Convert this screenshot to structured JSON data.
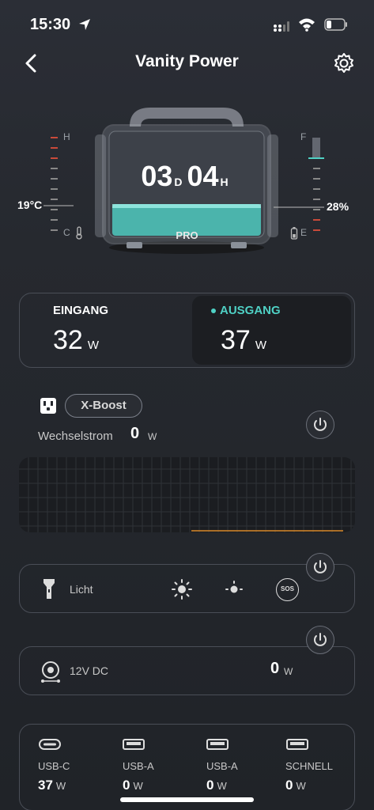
{
  "status_bar": {
    "time": "15:30"
  },
  "header": {
    "title": "Vanity Power"
  },
  "device": {
    "temperature": "19°C",
    "temp_scale_high": "H",
    "temp_scale_low": "C",
    "battery_percent": "28%",
    "battery_level": 0.28,
    "batt_scale_full": "F",
    "batt_scale_empty": "E",
    "runtime_days": "03",
    "runtime_days_unit": "D",
    "runtime_hours": "04",
    "runtime_hours_unit": "H",
    "model_label": "PRO"
  },
  "io": {
    "input_label": "EINGANG",
    "input_value": "32",
    "input_unit": "W",
    "output_label": "AUSGANG",
    "output_value": "37",
    "output_unit": "W"
  },
  "ac": {
    "boost_label": "X-Boost",
    "label": "Wechselstrom",
    "value": "0",
    "unit": "W"
  },
  "light": {
    "label": "Licht",
    "mode_sos": "SOS"
  },
  "dc": {
    "label": "12V DC",
    "value": "0",
    "unit": "W"
  },
  "usb": {
    "ports": [
      {
        "label": "USB-C",
        "value": "37",
        "unit": "W"
      },
      {
        "label": "USB-A",
        "value": "0",
        "unit": "W"
      },
      {
        "label": "USB-A",
        "value": "0",
        "unit": "W"
      },
      {
        "label": "SCHNELL",
        "value": "0",
        "unit": "W"
      }
    ]
  },
  "colors": {
    "accent": "#4fd1c5",
    "chart_line": "#d98a2b",
    "alert": "#c94a3a"
  }
}
